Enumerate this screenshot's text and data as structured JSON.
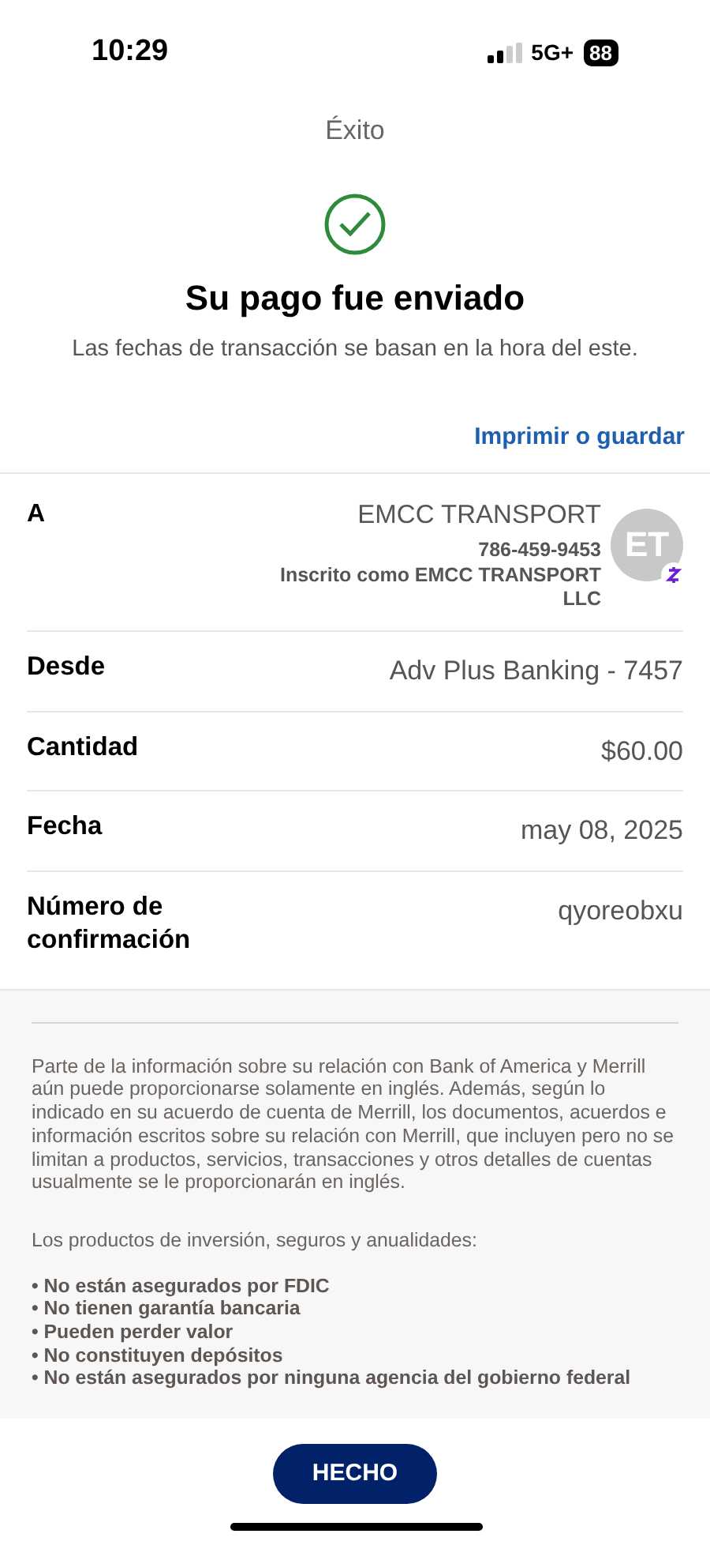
{
  "status_bar": {
    "time": "10:29",
    "network": "5G+",
    "battery": "88"
  },
  "header": {
    "title": "Éxito"
  },
  "success": {
    "heading": "Su pago fue enviado",
    "subtitle": "Las fechas de transacción se basan en la hora del este."
  },
  "print_link": "Imprimir o guardar",
  "recipient": {
    "label": "A",
    "name": "EMCC TRANSPORT",
    "phone": "786-459-9453",
    "enrolled": "Inscrito como EMCC TRANSPORT LLC",
    "initials": "ET"
  },
  "details": [
    {
      "label": "Desde",
      "value": "Adv Plus Banking - 7457"
    },
    {
      "label": "Cantidad",
      "value": "$60.00"
    },
    {
      "label": "Fecha",
      "value": "may 08, 2025"
    },
    {
      "label": "Número de confirmación",
      "value": "qyoreobxu"
    }
  ],
  "disclaimer": {
    "paragraph": "Parte de la información sobre su relación con Bank of America y Merrill aún puede proporcionarse solamente en inglés. Además, según lo indicado en su acuerdo de cuenta de Merrill, los documentos, acuerdos e información escritos sobre su relación con Merrill, que incluyen pero no se limitan a productos, servicios, transacciones y otros detalles de cuentas usualmente se le proporcionarán en inglés.",
    "intro": "Los productos de inversión, seguros y anualidades:",
    "bullets": [
      "• No están asegurados por FDIC",
      "• No tienen garantía bancaria",
      "• Pueden perder valor",
      "• No constituyen depósitos",
      "• No están asegurados por ninguna agencia del gobierno federal"
    ]
  },
  "done_button": "HECHO"
}
